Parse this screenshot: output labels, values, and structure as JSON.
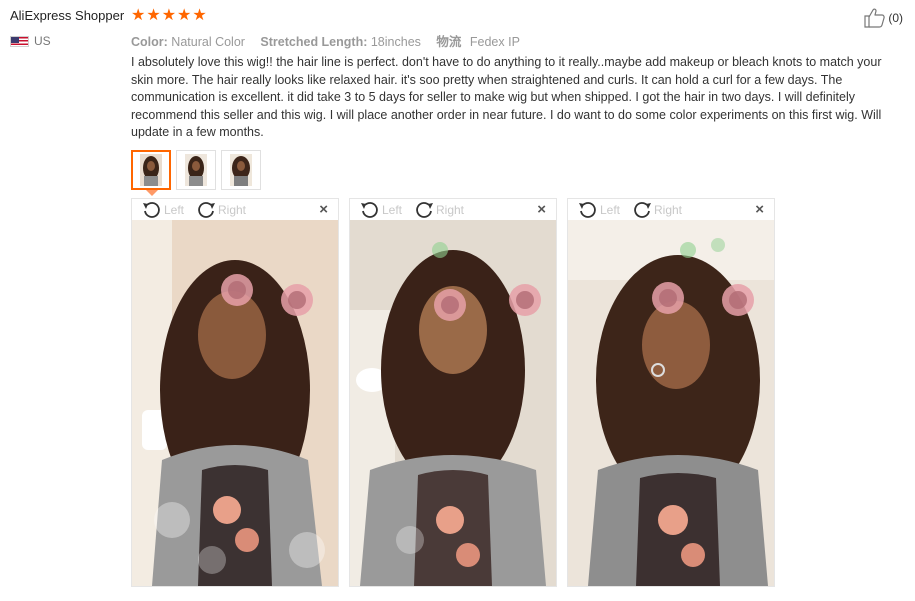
{
  "review": {
    "buyer_name": "AliExpress Shopper",
    "country": "US",
    "rating": 5,
    "helpful_count": "(0)",
    "attributes": {
      "color_label": "Color:",
      "color_value": "Natural Color",
      "length_label": "Stretched Length:",
      "length_value": "18inches",
      "shipping_label": "物流",
      "shipping_value": "Fedex IP"
    },
    "text": "I absolutely love this wig!! the hair line is perfect. don't have to do anything to it really..maybe add makeup or bleach knots to match your skin more. The hair really looks like relaxed hair. it's soo pretty when straightened and curls. It can hold a curl for a few days. The communication is excellent. it did take 3 to 5 days for seller to make wig but when shipped. I got the hair in two days. I will definitely recommend this seller and this wig. I will place another order in near future. I do want to do some color experiments on this first wig. Will update in a few months."
  },
  "image_viewer": {
    "rotate_left_label": "Left",
    "rotate_right_label": "Right",
    "close_glyph": "×",
    "thumbnail_count": 3,
    "active_thumbnail": 1
  },
  "icons": {
    "star": "star-icon",
    "thumbs_up": "thumbs-up-icon",
    "flag": "us-flag-icon",
    "rotate_left": "rotate-left-icon",
    "rotate_right": "rotate-right-icon",
    "close": "close-icon"
  },
  "colors": {
    "star": "#ff6600",
    "active_border": "#ff6600",
    "muted_text": "#999999"
  }
}
